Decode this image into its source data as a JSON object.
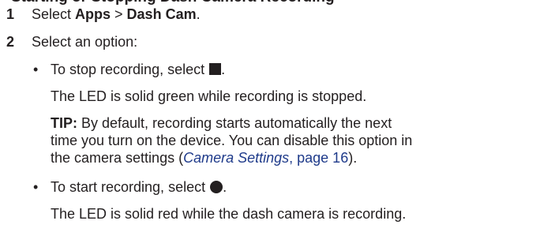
{
  "heading": "Starting or Stopping Dash Camera Recording",
  "steps": [
    {
      "number": "1",
      "prefix": "Select ",
      "item1": "Apps",
      "separator": " > ",
      "item2": "Dash Cam",
      "suffix": "."
    },
    {
      "number": "2",
      "text": "Select an option:"
    }
  ],
  "options": [
    {
      "bullet": "•",
      "text_before_icon": "To stop recording, select ",
      "icon": "stop-icon",
      "text_after_icon": ".",
      "result": "The LED is solid green while recording is stopped.",
      "tip_label": "TIP:",
      "tip_line1": " By default, recording starts automatically the next",
      "tip_line2": "time you turn on the device. You can disable this option in",
      "tip_line3_before": "the camera settings (",
      "tip_link": "Camera Settings",
      "tip_link_page": ", page 16",
      "tip_line3_after": ")."
    },
    {
      "bullet": "•",
      "text_before_icon": "To start recording, select ",
      "icon": "record-icon",
      "text_after_icon": ".",
      "result": "The LED is solid red while the dash camera is recording."
    }
  ]
}
